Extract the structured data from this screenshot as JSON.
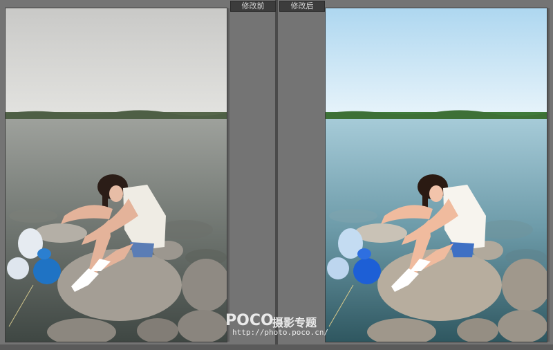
{
  "labels": {
    "before": "修改前",
    "after": "修改后"
  },
  "watermark": {
    "logo": "POCO",
    "title": "摄影专题",
    "url": "http://photo.poco.cn/"
  },
  "colors": {
    "background": "#747474",
    "divider": "#4a4a4a",
    "tag_bg": "#3c3c3c",
    "before_sky": "#d9d9d6",
    "after_sky": "#c4e3f4",
    "balloon_white": "#e8eef5",
    "balloon_blue": "#1f7ad1"
  }
}
